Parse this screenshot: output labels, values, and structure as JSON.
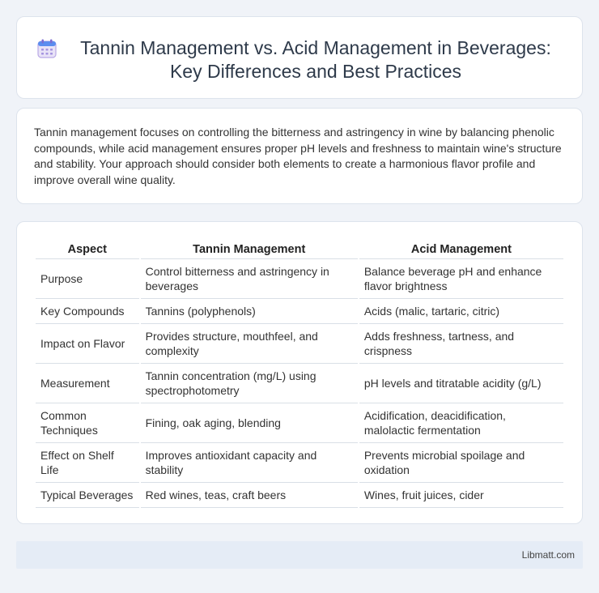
{
  "header": {
    "icon": "calendar-icon",
    "title": "Tannin Management vs. Acid Management in Beverages: Key Differences and Best Practices"
  },
  "intro": {
    "text": "Tannin management focuses on controlling the bitterness and astringency in wine by balancing phenolic compounds, while acid management ensures proper pH levels and freshness to maintain wine's structure and stability. Your approach should consider both elements to create a harmonious flavor profile and improve overall wine quality."
  },
  "table": {
    "headers": [
      "Aspect",
      "Tannin Management",
      "Acid Management"
    ],
    "rows": [
      [
        "Purpose",
        "Control bitterness and astringency in beverages",
        "Balance beverage pH and enhance flavor brightness"
      ],
      [
        "Key Compounds",
        "Tannins (polyphenols)",
        "Acids (malic, tartaric, citric)"
      ],
      [
        "Impact on Flavor",
        "Provides structure, mouthfeel, and complexity",
        "Adds freshness, tartness, and crispness"
      ],
      [
        "Measurement",
        "Tannin concentration (mg/L) using spectrophotometry",
        "pH levels and titratable acidity (g/L)"
      ],
      [
        "Common Techniques",
        "Fining, oak aging, blending",
        "Acidification, deacidification, malolactic fermentation"
      ],
      [
        "Effect on Shelf Life",
        "Improves antioxidant capacity and stability",
        "Prevents microbial spoilage and oxidation"
      ],
      [
        "Typical Beverages",
        "Red wines, teas, craft beers",
        "Wines, fruit juices, cider"
      ]
    ]
  },
  "footer": {
    "brand": "Libmatt.com"
  }
}
